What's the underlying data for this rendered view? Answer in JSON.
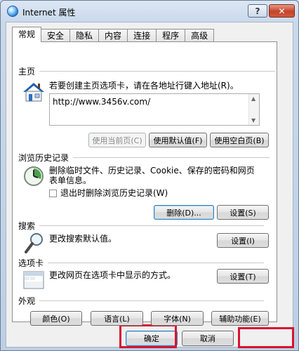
{
  "window": {
    "title": "Internet 属性",
    "help_label": "?",
    "close_label": "✕"
  },
  "tabs": [
    {
      "label": "常规",
      "active": true
    },
    {
      "label": "安全"
    },
    {
      "label": "隐私"
    },
    {
      "label": "内容"
    },
    {
      "label": "连接"
    },
    {
      "label": "程序"
    },
    {
      "label": "高级"
    }
  ],
  "home": {
    "heading": "主页",
    "description": "若要创建主页选项卡，请在各地址行键入地址(R)。",
    "url": "http://www.3456v.com/",
    "use_current": "使用当前页(C)",
    "use_default": "使用默认值(F)",
    "use_blank": "使用空白页(B)"
  },
  "history": {
    "heading": "浏览历史记录",
    "description_line1": "删除临时文件、历史记录、Cookie、保存的密码和网页",
    "description_line2": "表单信息。",
    "checkbox_label": "退出时删除浏览历史记录(W)",
    "delete_label": "删除(D)...",
    "settings_label": "设置(S)"
  },
  "search": {
    "heading": "搜索",
    "description": "更改搜索默认值。",
    "settings_label": "设置(I)"
  },
  "tabs_section": {
    "heading": "选项卡",
    "description": "更改网页在选项卡中显示的方式。",
    "settings_label": "设置(T)"
  },
  "appearance": {
    "heading": "外观",
    "colors": "颜色(O)",
    "languages": "语言(L)",
    "fonts": "字体(N)",
    "accessibility": "辅助功能(E)"
  },
  "footer": {
    "ok": "确定",
    "cancel": "取消"
  },
  "colors": {
    "highlight": "#d8142f",
    "titlebar": "#c9d9ec",
    "close": "#c2432a"
  }
}
